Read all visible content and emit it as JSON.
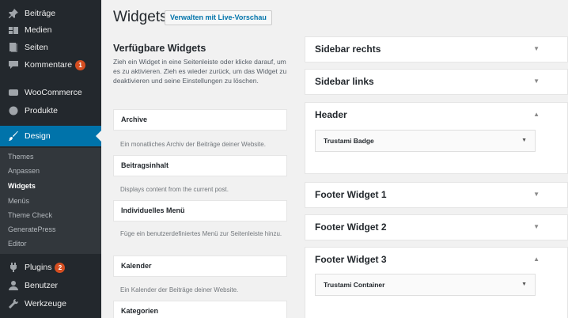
{
  "sidebar": {
    "items": [
      {
        "label": "Beiträge",
        "icon": "pin-icon"
      },
      {
        "label": "Medien",
        "icon": "media-icon"
      },
      {
        "label": "Seiten",
        "icon": "page-icon"
      },
      {
        "label": "Kommentare",
        "icon": "comment-icon",
        "badge": "1"
      },
      {
        "label": "WooCommerce",
        "icon": "woo-icon"
      },
      {
        "label": "Produkte",
        "icon": "product-icon"
      },
      {
        "label": "Design",
        "icon": "brush-icon"
      },
      {
        "label": "Plugins",
        "icon": "plugin-icon",
        "badge": "2"
      },
      {
        "label": "Benutzer",
        "icon": "user-icon"
      },
      {
        "label": "Werkzeuge",
        "icon": "wrench-icon"
      }
    ],
    "submenu": [
      "Themes",
      "Anpassen",
      "Widgets",
      "Menüs",
      "Theme Check",
      "GeneratePress",
      "Editor"
    ],
    "current_sub": "Widgets",
    "accent": "#0073aa",
    "badge_color": "#d54e21"
  },
  "header": {
    "title": "Widgets",
    "live_button": "Verwalten mit Live-Vorschau"
  },
  "available": {
    "title": "Verfügbare Widgets",
    "description": "Zieh ein Widget in eine Seitenleiste oder klicke darauf, um es zu aktivieren. Zieh es wieder zurück, um das Widget zu deaktivieren und seine Einstellungen zu löschen.",
    "widgets": [
      {
        "name": "Archive",
        "desc": "Ein monatliches Archiv der Beiträge deiner Website."
      },
      {
        "name": "Beitragsinhalt",
        "desc": "Displays content from the current post."
      },
      {
        "name": "Individuelles Menü",
        "desc": "Füge ein benutzerdefiniertes Menü zur Seitenleiste hinzu."
      },
      {
        "name": "Kalender",
        "desc": "Ein Kalender der Beiträge deiner Website."
      },
      {
        "name": "Kategorien",
        "desc": ""
      }
    ]
  },
  "areas": [
    {
      "title": "Sidebar rechts",
      "expanded": false
    },
    {
      "title": "Sidebar links",
      "expanded": false
    },
    {
      "title": "Header",
      "expanded": true,
      "widget": "Trustami Badge"
    },
    {
      "title": "Footer Widget 1",
      "expanded": false
    },
    {
      "title": "Footer Widget 2",
      "expanded": false
    },
    {
      "title": "Footer Widget 3",
      "expanded": true,
      "widget": "Trustami Container"
    }
  ],
  "glyphs": {
    "arrow_down": "▼",
    "arrow_up": "▲"
  }
}
